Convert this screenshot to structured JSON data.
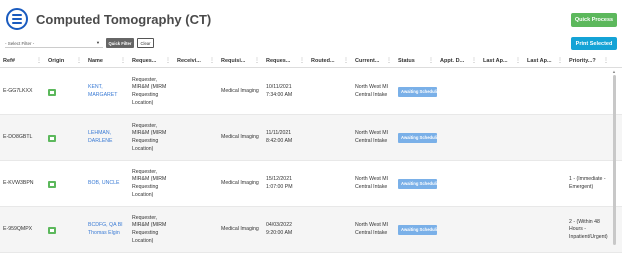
{
  "header": {
    "title": "Computed Tomography (CT)",
    "quick_process_label": "Quick Process"
  },
  "toolbar": {
    "filter_placeholder": "- Select Filter -",
    "quick_filter_label": "Quick Filter",
    "clear_label": "Clear",
    "print_selected_label": "Print Selected"
  },
  "table": {
    "columns": [
      "Ref#",
      "Origin",
      "Name",
      "Reques...",
      "Receivi...",
      "Requisi...",
      "Reques...",
      "Routed...",
      "Current...",
      "Status",
      "Appt. D...",
      "Last Ap...",
      "Last Ap...",
      "Priority...?"
    ],
    "rows": [
      {
        "ref": "E-GG7LKXX",
        "name": [
          "KENT,",
          "MARGARET"
        ],
        "requester": [
          "Requester,",
          "MIR&M (MIRM",
          "Requesting",
          "Location)"
        ],
        "requisition": "Medical Imaging",
        "requested": [
          "10/11/2021",
          "7:34:00 AM"
        ],
        "current": [
          "North West MI",
          "Central Intake"
        ],
        "status": "Awaiting Scheduling",
        "priority": []
      },
      {
        "ref": "E-DO8GBTL",
        "name": [
          "LEHMAN,",
          "DARLENE"
        ],
        "requester": [
          "Requester,",
          "MIR&M (MIRM",
          "Requesting",
          "Location)"
        ],
        "requisition": "Medical Imaging",
        "requested": [
          "11/11/2021",
          "8:42:00 AM"
        ],
        "current": [
          "North West MI",
          "Central Intake"
        ],
        "status": "Awaiting Scheduling",
        "priority": []
      },
      {
        "ref": "E-KVW3BPN",
        "name": [
          "BOB, UNCLE"
        ],
        "requester": [
          "Requester,",
          "MIR&M (MIRM",
          "Requesting",
          "Location)"
        ],
        "requisition": "Medical Imaging",
        "requested": [
          "15/12/2021",
          "1:07:00 PM"
        ],
        "current": [
          "North West MI",
          "Central Intake"
        ],
        "status": "Awaiting Scheduling",
        "priority": [
          "1 - (Immediate -",
          "Emergent)"
        ]
      },
      {
        "ref": "E-959QMPX",
        "name": [
          "BCDFG, QA BI",
          "Thomas Elgin"
        ],
        "requester": [
          "Requester,",
          "MIR&M (MIRM",
          "Requesting",
          "Location)"
        ],
        "requisition": "Medical Imaging",
        "requested": [
          "04/03/2022",
          "9:20:00 AM"
        ],
        "current": [
          "North West MI",
          "Central Intake"
        ],
        "status": "Awaiting Scheduling",
        "priority": [
          "2 - (Within 48",
          "Hours -",
          "Inpatient/Urgent)"
        ]
      }
    ]
  },
  "icons": {
    "menu": "menu-icon",
    "origin": "origin-icon",
    "column_menu": "column-menu-icon"
  },
  "colors": {
    "accent": "#1a5bbf",
    "quick_process": "#5cb85c",
    "print_selected": "#14a3d6",
    "status_badge": "#7ab0e8",
    "link": "#3a7bd5"
  }
}
